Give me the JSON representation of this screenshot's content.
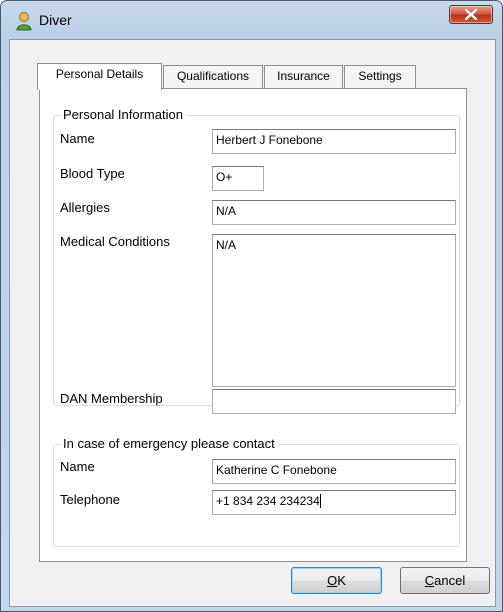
{
  "window": {
    "title": "Diver",
    "close_glyph": "X"
  },
  "tabs": [
    {
      "label": "Personal Details",
      "active": true
    },
    {
      "label": "Qualifications",
      "active": false
    },
    {
      "label": "Insurance",
      "active": false
    },
    {
      "label": "Settings",
      "active": false
    }
  ],
  "personal_info": {
    "legend": "Personal Information",
    "name_label": "Name",
    "name_value": "Herbert J Fonebone",
    "blood_type_label": "Blood Type",
    "blood_type_value": "O+",
    "allergies_label": "Allergies",
    "allergies_value": "N/A",
    "medical_label": "Medical Conditions",
    "medical_value": "N/A",
    "dan_label": "DAN Membership",
    "dan_value": ""
  },
  "emergency": {
    "legend": "In case of emergency please contact",
    "name_label": "Name",
    "name_value": "Katherine C Fonebone",
    "telephone_label": "Telephone",
    "telephone_value": "+1 834 234 234234"
  },
  "buttons": {
    "ok_mnemonic": "O",
    "ok_rest": "K",
    "cancel_mnemonic": "C",
    "cancel_rest": "ancel"
  },
  "colors": {
    "window_frame": "#bcd0e8",
    "dialog_face": "#f0f0f0",
    "close_button": "#c9462c"
  },
  "icons": {
    "title": "user-icon",
    "close": "close-icon"
  }
}
